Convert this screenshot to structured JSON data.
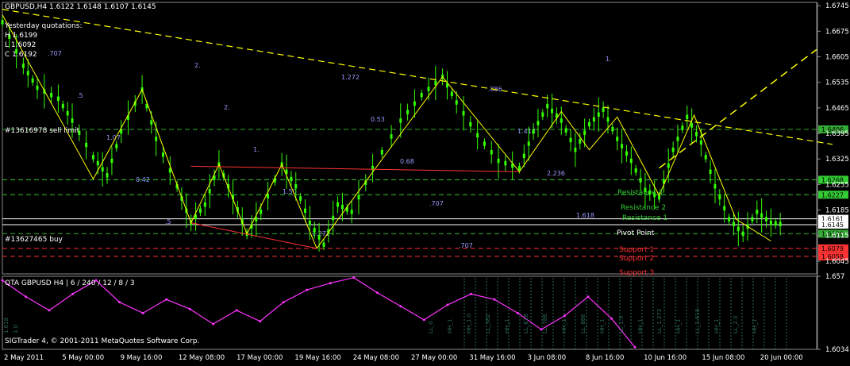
{
  "header": {
    "symbol_info": "GBPUSD,H4  1.6122 1.6148 1.6107 1.6145",
    "yesterday_title": "Yesterday quotations:",
    "high": "H 1.6199",
    "low": "L 1.6092",
    "close": "C 1.6192"
  },
  "indicator": {
    "title": "QTA GBPUSD H4 | 6 / 240 / 12 / 8 / 3"
  },
  "copyright": "SIGTrader 4, © 2001-2011 MetaQuotes Software Corp.",
  "orders": {
    "sell": "#13616978 sell limit",
    "buy": "#13627465 buy"
  },
  "levels": {
    "resistance3": "Resistance 3",
    "resistance2": "Resistance 2",
    "resistance1": "Resistance 1",
    "pivot": "Pivot Point",
    "support1": "Support 1",
    "support2": "Support 2",
    "support3": "Support 3"
  },
  "colors": {
    "background": "#000000",
    "candle": "#33ff00",
    "trend": "#ffff00",
    "fib": "#9999ff",
    "support": "#ff3333",
    "indicator": "#ff33ff",
    "grid": "#2a6a5a"
  },
  "chart_data": [
    {
      "type": "line",
      "title": "GBPUSD,H4",
      "ylim": [
        1.601,
        1.6754
      ],
      "y_ticks": [
        "1.6745",
        "1.6675",
        "1.6605",
        "1.6535",
        "1.6465",
        "1.6395",
        "1.6325",
        "1.6255",
        "1.6185",
        "1.6115",
        "1.6045"
      ],
      "x_ticks": [
        "2 May 2011",
        "5 May 00:00",
        "9 May 16:00",
        "12 May 08:00",
        "17 May 00:00",
        "19 May 16:00",
        "24 May 08:00",
        "27 May 00:00",
        "31 May 16:00",
        "3 Jun 08:00",
        "8 Jun 16:00",
        "10 Jun 16:00",
        "15 Jun 08:00",
        "20 Jun 00:00"
      ],
      "price_path": [
        [
          0,
          1.67
        ],
        [
          3,
          1.658
        ],
        [
          5,
          1.652
        ],
        [
          8,
          1.649
        ],
        [
          10,
          1.643
        ],
        [
          13,
          1.633
        ],
        [
          15,
          1.628
        ],
        [
          17,
          1.64
        ],
        [
          20,
          1.6515
        ],
        [
          22,
          1.638
        ],
        [
          25,
          1.625
        ],
        [
          27,
          1.615
        ],
        [
          29,
          1.62
        ],
        [
          31,
          1.631
        ],
        [
          33,
          1.622
        ],
        [
          35,
          1.612
        ],
        [
          37,
          1.618
        ],
        [
          40,
          1.631
        ],
        [
          42,
          1.625
        ],
        [
          44,
          1.615
        ],
        [
          46,
          1.609
        ],
        [
          48,
          1.62
        ],
        [
          50,
          1.618
        ],
        [
          53,
          1.63
        ],
        [
          57,
          1.643
        ],
        [
          60,
          1.65
        ],
        [
          63,
          1.655
        ],
        [
          65,
          1.648
        ],
        [
          68,
          1.639
        ],
        [
          71,
          1.632
        ],
        [
          74,
          1.63
        ],
        [
          76,
          1.64
        ],
        [
          78,
          1.647
        ],
        [
          80,
          1.643
        ],
        [
          82,
          1.635
        ],
        [
          84,
          1.642
        ],
        [
          86,
          1.646
        ],
        [
          88,
          1.638
        ],
        [
          90,
          1.632
        ],
        [
          92,
          1.624
        ],
        [
          94,
          1.622
        ],
        [
          96,
          1.635
        ],
        [
          98,
          1.644
        ],
        [
          100,
          1.637
        ],
        [
          102,
          1.625
        ],
        [
          104,
          1.616
        ],
        [
          106,
          1.612
        ],
        [
          108,
          1.618
        ],
        [
          110,
          1.615
        ],
        [
          112,
          1.6145
        ]
      ],
      "zigzag": [
        [
          0,
          1.672
        ],
        [
          13,
          1.627
        ],
        [
          20,
          1.6515
        ],
        [
          27,
          1.615
        ],
        [
          31,
          1.631
        ],
        [
          35,
          1.612
        ],
        [
          40,
          1.631
        ],
        [
          45,
          1.608
        ],
        [
          63,
          1.655
        ],
        [
          74,
          1.629
        ],
        [
          80,
          1.6455
        ],
        [
          84,
          1.635
        ],
        [
          88,
          1.644
        ],
        [
          94,
          1.6225
        ],
        [
          99,
          1.6445
        ],
        [
          105,
          1.616
        ],
        [
          110,
          1.61
        ]
      ],
      "horizontal_levels": [
        {
          "name": "sell limit",
          "value": 1.6406,
          "color": "#33aa33",
          "label": "1.6406"
        },
        {
          "name": "resistance3",
          "value": 1.6268,
          "color": "#33cc33",
          "label": "1.6268"
        },
        {
          "name": "resistance2",
          "value": 1.6227,
          "color": "#33cc33",
          "label": "1.6227"
        },
        {
          "name": "current",
          "value": 1.6161,
          "color": "#ffffff",
          "label": "1.6161"
        },
        {
          "name": "close",
          "value": 1.6145,
          "color": "#ffffff",
          "label": "1.6145"
        },
        {
          "name": "buy",
          "value": 1.612,
          "color": "#33aa33",
          "label": "1.6120"
        },
        {
          "name": "support1",
          "value": 1.608,
          "color": "#ff3333",
          "label": "1.6079"
        },
        {
          "name": "support3",
          "value": 1.6058,
          "color": "#ff3333",
          "label": "1.6058"
        }
      ],
      "fib_labels": [
        ".707",
        ".5",
        "1.07",
        "0.42",
        ".5",
        "2.",
        "2.",
        "1.",
        "1.50",
        "1.272",
        "1.272",
        "0.53",
        "0.68",
        ".707",
        ".707",
        ".886",
        "1.414",
        "2.236",
        "1.618",
        "1."
      ]
    },
    {
      "type": "line",
      "title": "QTA GBPUSD H4 | 6 / 240 / 12 / 8 / 3",
      "ylim": [
        1.6034,
        1.657
      ],
      "y_ticks": [
        "1.657",
        "1.6034"
      ],
      "series": [
        {
          "values": [
            [
              0,
              1.654
            ],
            [
              4,
              1.642
            ],
            [
              8,
              1.632
            ],
            [
              12,
              1.644
            ],
            [
              16,
              1.654
            ],
            [
              20,
              1.638
            ],
            [
              24,
              1.63
            ],
            [
              28,
              1.64
            ],
            [
              32,
              1.633
            ],
            [
              36,
              1.622
            ],
            [
              40,
              1.632
            ],
            [
              44,
              1.624
            ],
            [
              48,
              1.638
            ],
            [
              52,
              1.647
            ],
            [
              56,
              1.652
            ],
            [
              60,
              1.656
            ],
            [
              64,
              1.645
            ],
            [
              68,
              1.635
            ],
            [
              72,
              1.625
            ],
            [
              76,
              1.636
            ],
            [
              80,
              1.644
            ],
            [
              84,
              1.64
            ],
            [
              88,
              1.63
            ],
            [
              92,
              1.618
            ],
            [
              96,
              1.628
            ],
            [
              100,
              1.642
            ],
            [
              104,
              1.626
            ],
            [
              108,
              1.605
            ]
          ]
        }
      ],
      "vertical_labels": [
        "1.618",
        "1.0",
        "LL_0",
        "HH_1",
        "HH_1.0",
        "LL_382",
        "HH_1",
        "LL_618",
        "LL_786",
        "HH_1",
        "LL_886",
        "HH_1",
        "LL_1.0",
        "HH_1",
        "LL_1.272",
        "HH_1",
        "LL_1.618",
        "HH_1",
        "LL_2.0",
        "HH_1"
      ]
    }
  ]
}
